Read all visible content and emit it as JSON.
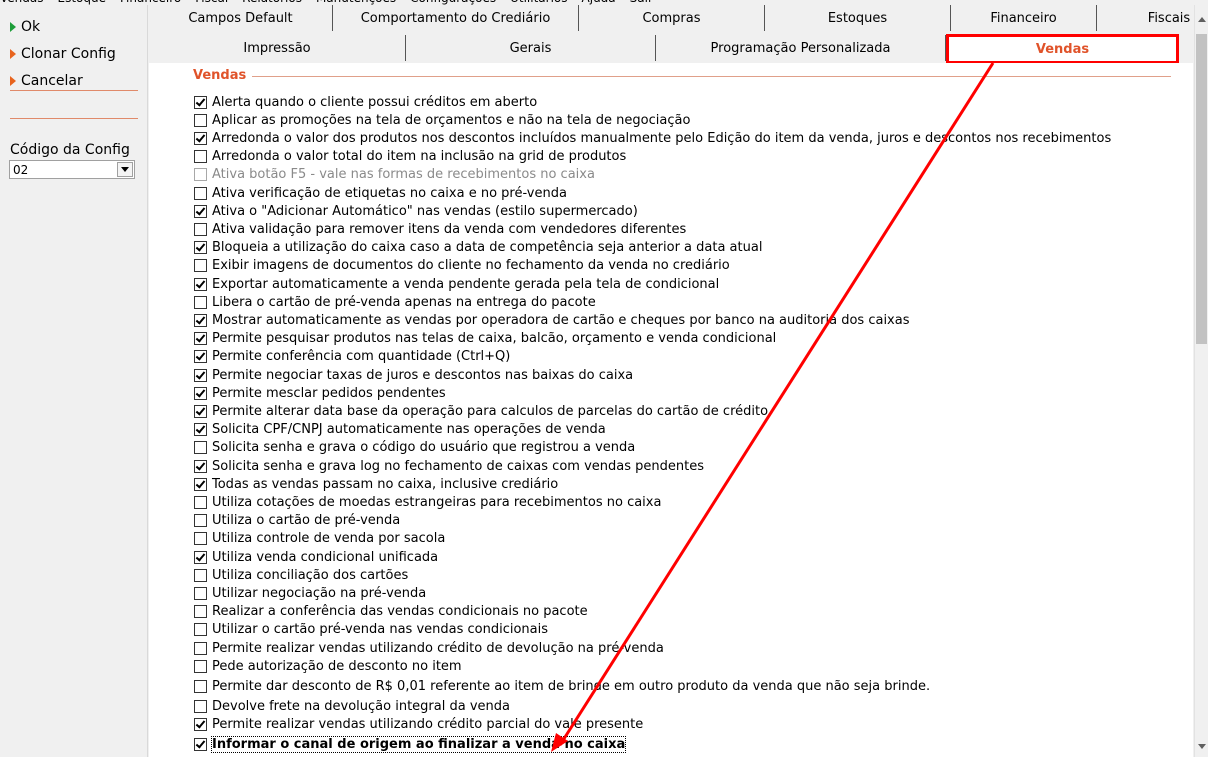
{
  "menubar": [
    "Vendas",
    "Estoque",
    "Financeiro",
    "Fiscal",
    "Relatórios",
    "Manutenções",
    "Configurações",
    "Utilitários",
    "Ajuda",
    "Sair"
  ],
  "sidebar": {
    "ok_label": "Ok",
    "clone_label": "Clonar Config",
    "cancel_label": "Cancelar",
    "code_label": "Código da Config",
    "code_value": "02"
  },
  "tabs_row1": [
    "Campos Default",
    "Comportamento do Crediário",
    "Compras",
    "Estoques",
    "Financeiro",
    "Fiscais"
  ],
  "tabs_row2": [
    "Impressão",
    "Gerais",
    "Programação Personalizada",
    "Vendas"
  ],
  "active_tab": "Vendas",
  "group_title": "Vendas",
  "options": [
    {
      "label": "Alerta quando o cliente possui créditos em aberto",
      "checked": true
    },
    {
      "label": "Aplicar as promoções na tela de orçamentos e não na tela de negociação",
      "checked": false
    },
    {
      "label": "Arredonda o valor dos produtos nos descontos incluídos manualmente pelo Edição do item da venda, juros e descontos nos recebimentos",
      "checked": true
    },
    {
      "label": "Arredonda o valor total do item na inclusão na grid de produtos",
      "checked": false
    },
    {
      "label": "Ativa botão F5 - vale nas formas de recebimentos no caixa",
      "checked": false,
      "disabled": true
    },
    {
      "label": "Ativa verificação de etiquetas no caixa e no pré-venda",
      "checked": false
    },
    {
      "label": "Ativa o \"Adicionar Automático\"  nas vendas (estilo supermercado)",
      "checked": true
    },
    {
      "label": "Ativa validação para remover itens da venda com vendedores diferentes",
      "checked": false
    },
    {
      "label": "Bloqueia a utilização do caixa caso a data de competência seja anterior a data atual",
      "checked": true
    },
    {
      "label": "Exibir imagens de documentos do cliente no fechamento da venda no crediário",
      "checked": false
    },
    {
      "label": "Exportar automaticamente a venda pendente gerada pela tela de condicional",
      "checked": true
    },
    {
      "label": "Libera o cartão de pré-venda apenas na entrega do pacote",
      "checked": false
    },
    {
      "label": "Mostrar automaticamente as vendas por operadora de cartão e cheques por banco na auditoria dos caixas",
      "checked": true
    },
    {
      "label": "Permite pesquisar produtos nas telas de caixa, balcão, orçamento e venda condicional",
      "checked": true
    },
    {
      "label": "Permite conferência com quantidade (Ctrl+Q)",
      "checked": true
    },
    {
      "label": "Permite negociar taxas de juros e descontos nas baixas do caixa",
      "checked": true
    },
    {
      "label": "Permite mesclar pedidos pendentes",
      "checked": true
    },
    {
      "label": "Permite alterar data base da operação para calculos de parcelas do cartão de crédito",
      "checked": true
    },
    {
      "label": "Solicita CPF/CNPJ automaticamente nas operações de venda",
      "checked": true
    },
    {
      "label": "Solicita senha e grava o código do usuário que registrou a venda",
      "checked": false
    },
    {
      "label": "Solicita senha e grava log no fechamento de caixas com vendas pendentes",
      "checked": true
    },
    {
      "label": "Todas as vendas passam no caixa, inclusive crediário",
      "checked": true
    },
    {
      "label": "Utiliza cotações de moedas estrangeiras para recebimentos no caixa",
      "checked": false
    },
    {
      "label": "Utiliza o cartão de pré-venda",
      "checked": false
    },
    {
      "label": "Utiliza controle de venda por sacola",
      "checked": false
    },
    {
      "label": "Utiliza venda condicional unificada",
      "checked": true
    },
    {
      "label": "Utiliza conciliação dos cartões",
      "checked": false
    },
    {
      "label": "Utilizar negociação na pré-venda",
      "checked": false
    },
    {
      "label": "Realizar a conferência das vendas condicionais no pacote",
      "checked": false
    },
    {
      "label": "Utilizar o cartão pré-venda nas vendas condicionais",
      "checked": false
    },
    {
      "label": "Permite realizar vendas utilizando crédito de devolução na pré-venda",
      "checked": false
    },
    {
      "label": "Pede autorização de desconto no item",
      "checked": false
    },
    {
      "label": "Permite dar desconto de R$ 0,01 referente ao item de brinde em outro produto da venda que não seja brinde.",
      "checked": false
    },
    {
      "label": "Devolve frete na devolução integral da venda",
      "checked": false
    },
    {
      "label": "Permite realizar vendas utilizando crédito parcial do vale presente",
      "checked": true
    },
    {
      "label": "Informar o canal de origem ao finalizar a venda no caixa",
      "checked": true,
      "focused": true
    }
  ]
}
